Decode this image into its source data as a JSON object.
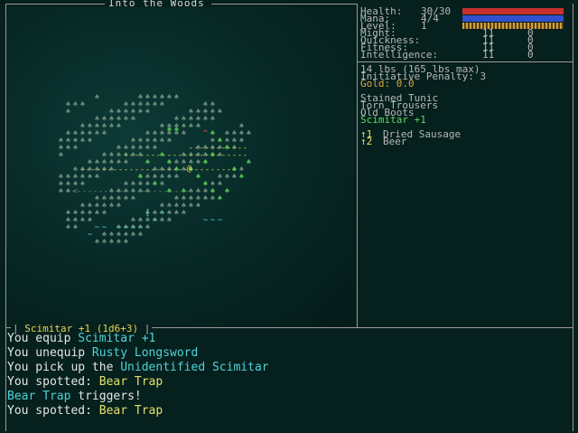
{
  "map": {
    "title": "Into the Woods"
  },
  "stats": {
    "health_label": "Health:",
    "health_value": "30/30",
    "mana_label": "Mana:",
    "mana_value": "4/4",
    "level_label": "Level:",
    "level_value": "1",
    "health_color": "#c83030",
    "mana_color": "#3050d0",
    "xp_color": "#d0a040",
    "health_fraction": 1.0,
    "mana_fraction": 1.0,
    "attributes": [
      {
        "label": "Might:",
        "value": "11",
        "mod": "0"
      },
      {
        "label": "Quickness:",
        "value": "11",
        "mod": "0"
      },
      {
        "label": "Fitness:",
        "value": "11",
        "mod": "0"
      },
      {
        "label": "Intelligence:",
        "value": "11",
        "mod": "0"
      }
    ]
  },
  "inventory": {
    "weight": "14 lbs (165 lbs max)",
    "initiative": "Initiative Penalty: 3",
    "gold": "Gold: 0.0",
    "equipment": [
      "Stained Tunic",
      "Torn Trousers",
      "Old Boots"
    ],
    "equipped_weapon": "Scimitar +1",
    "consumables": [
      {
        "key": "↑1",
        "name": "Dried Sausage"
      },
      {
        "key": "↑2",
        "name": "Beer"
      }
    ]
  },
  "weapon_bar": {
    "label": "Scimitar +1 (1d6+3)"
  },
  "log": [
    {
      "parts": [
        {
          "t": "You equip ",
          "c": "white"
        },
        {
          "t": "Scimitar +1",
          "c": "cyan"
        }
      ]
    },
    {
      "parts": [
        {
          "t": "You unequip ",
          "c": "white"
        },
        {
          "t": "Rusty Longsword",
          "c": "cyan"
        }
      ]
    },
    {
      "parts": [
        {
          "t": "You pick up the ",
          "c": "white"
        },
        {
          "t": "Unidentified Scimitar",
          "c": "cyan"
        }
      ]
    },
    {
      "parts": [
        {
          "t": "You spotted: ",
          "c": "white"
        },
        {
          "t": "Bear Trap",
          "c": "yellow"
        }
      ]
    },
    {
      "parts": [
        {
          "t": "Bear Trap",
          "c": "cyan"
        },
        {
          "t": " triggers!",
          "c": "white"
        }
      ]
    },
    {
      "parts": [
        {
          "t": "You spotted: ",
          "c": "white"
        },
        {
          "t": "Bear Trap",
          "c": "yellow"
        }
      ]
    }
  ],
  "colors": {
    "background": "#05201d",
    "frame": "#9a9a9a",
    "player": "#e8d650",
    "tree": "#4fbf4f",
    "tree_dim": "#6a8a7a",
    "path": "#d8d050",
    "water": "#4fd3d8",
    "hazard": "#e05050"
  },
  "glyphs": {
    "tree": "♠",
    "player": "@",
    "path": "-",
    "water": "~",
    "hazard": "^",
    "item": "[",
    "exit": "<"
  }
}
